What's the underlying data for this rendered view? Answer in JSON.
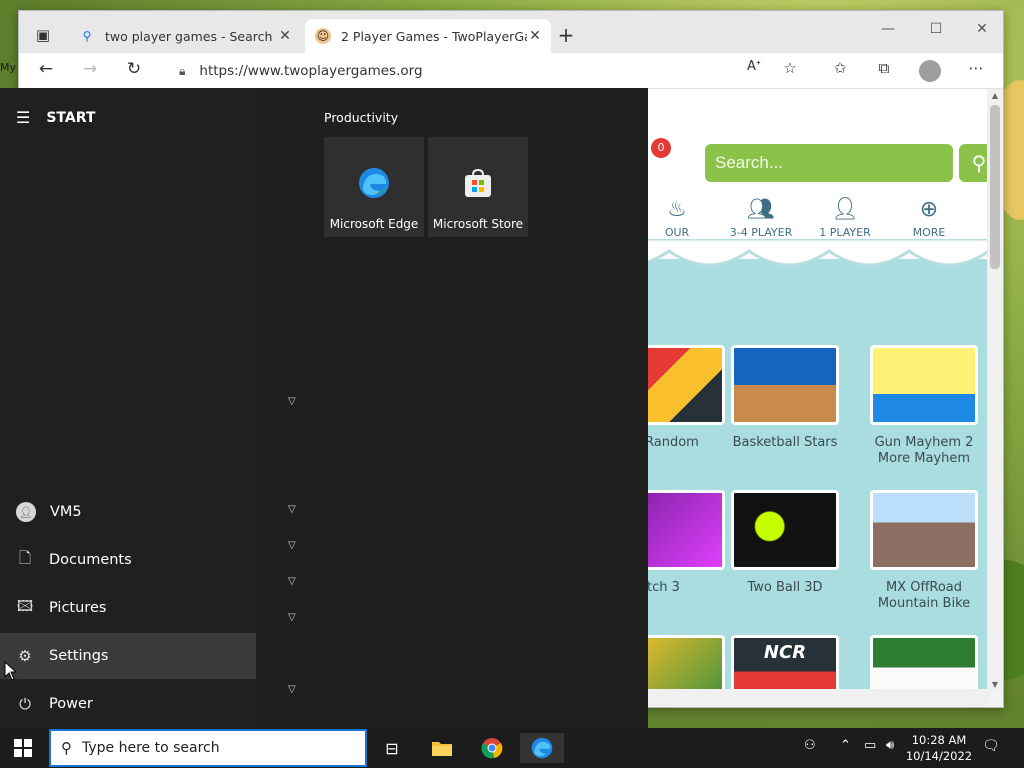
{
  "desktop": {
    "edge_label": "My"
  },
  "browser": {
    "tabs": [
      {
        "title": "two player games - Search",
        "favicon": "search-icon",
        "active": false
      },
      {
        "title": "2 Player Games - TwoPlayerGam",
        "favicon": "smiley-icon",
        "active": true
      }
    ],
    "url": "https://www.twoplayergames.org"
  },
  "site": {
    "notification_count": "0",
    "search_placeholder": "Search...",
    "categories": [
      {
        "label": "OUR",
        "icon": "flame-icon"
      },
      {
        "label": "3-4 PLAYER",
        "icon": "group-icon"
      },
      {
        "label": "1 PLAYER",
        "icon": "person-icon"
      },
      {
        "label": "MORE",
        "icon": "plus-circle-icon"
      }
    ],
    "games": [
      {
        "name": "Random"
      },
      {
        "name": "Basketball Stars"
      },
      {
        "name": "Gun Mayhem 2 More Mayhem"
      },
      {
        "name": "tch 3"
      },
      {
        "name": "Two Ball 3D"
      },
      {
        "name": "MX OffRoad Mountain Bike"
      },
      {
        "name": ""
      },
      {
        "name": "NCR"
      },
      {
        "name": ""
      }
    ]
  },
  "start_menu": {
    "header": "START",
    "group_title": "Productivity",
    "tiles": [
      {
        "label": "Microsoft Edge",
        "icon": "edge-icon"
      },
      {
        "label": "Microsoft Store",
        "icon": "store-icon"
      }
    ],
    "side": [
      {
        "label": "VM5",
        "icon": "user-icon"
      },
      {
        "label": "Documents",
        "icon": "document-icon"
      },
      {
        "label": "Pictures",
        "icon": "pictures-icon"
      },
      {
        "label": "Settings",
        "icon": "gear-icon"
      },
      {
        "label": "Power",
        "icon": "power-icon"
      }
    ]
  },
  "taskbar": {
    "search_placeholder": "Type here to search",
    "time": "10:28 AM",
    "date": "10/14/2022"
  }
}
